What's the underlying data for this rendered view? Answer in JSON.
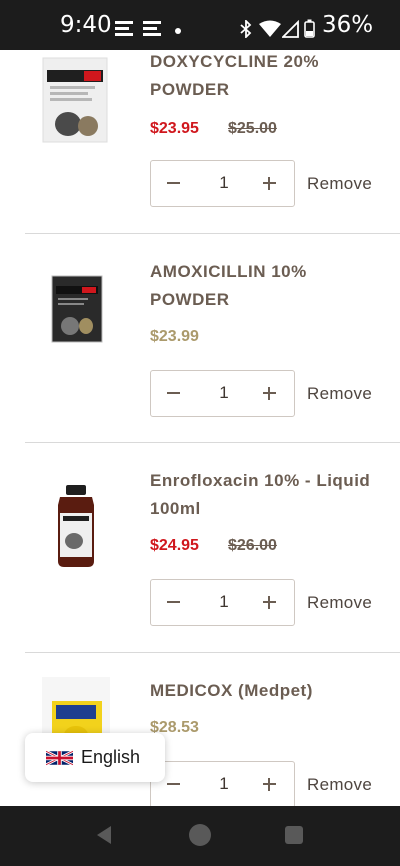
{
  "status_bar": {
    "time": "9:40",
    "battery_percent": "36%",
    "icons": [
      "email-icon",
      "email-icon",
      "notification-dot-icon",
      "bluetooth-icon",
      "wifi-icon",
      "cellular-signal-icon",
      "battery-icon"
    ]
  },
  "cart": {
    "items": [
      {
        "name_line1": "DOXYCYCLINE 20%",
        "name_line2": "POWDER",
        "price_sale": "$23.95",
        "price_original": "$25.00",
        "quantity": "1",
        "remove_label": "Remove"
      },
      {
        "name_line1": "AMOXICILLIN 10%",
        "name_line2": "POWDER",
        "price": "$23.99",
        "quantity": "1",
        "remove_label": "Remove"
      },
      {
        "name_line1": "Enrofloxacin 10% - Liquid",
        "name_line2": "100ml",
        "price_sale": "$24.95",
        "price_original": "$26.00",
        "quantity": "1",
        "remove_label": "Remove"
      },
      {
        "name_line1": "MEDICOX (Medpet)",
        "price": "$28.53",
        "quantity": "1",
        "remove_label": "Remove"
      }
    ]
  },
  "language_selector": {
    "label": "English",
    "flag_icon": "uk-flag-icon"
  },
  "colors": {
    "sale_price": "#d0171d",
    "regular_price": "#ab9a6c",
    "text": "#6b5d52",
    "system_bar": "#1c1c1c"
  },
  "nav_bar": {
    "icons": [
      "back-icon",
      "home-icon",
      "recents-icon"
    ]
  }
}
